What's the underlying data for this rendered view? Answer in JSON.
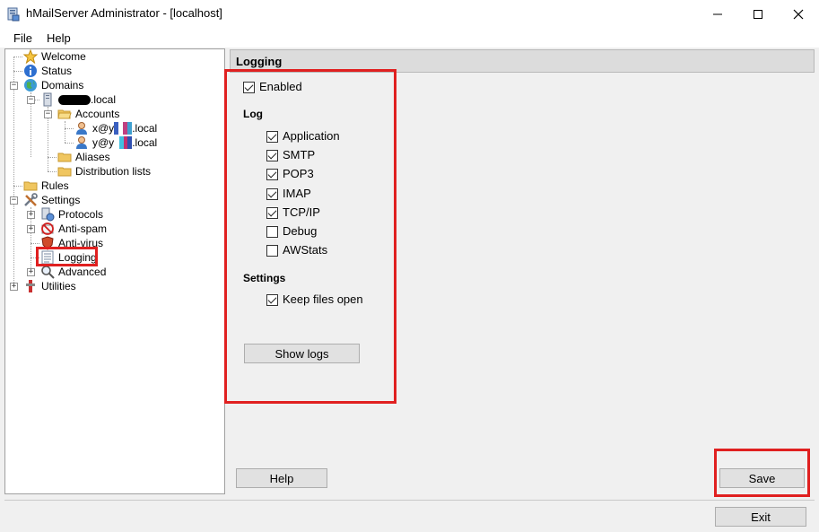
{
  "window": {
    "title": "hMailServer Administrator - [localhost]",
    "icons": [
      "app-icon",
      "minimize-icon",
      "maximize-icon",
      "close-icon"
    ]
  },
  "menu": {
    "file": "File",
    "help": "Help"
  },
  "tree": {
    "welcome": "Welcome",
    "status": "Status",
    "domains": "Domains",
    "domain_name": ".local",
    "accounts": "Accounts",
    "account1_prefix": "x@y",
    "account1_suffix": ".local",
    "account2_prefix": "y@y",
    "account2_suffix": ".local",
    "aliases": "Aliases",
    "distribution_lists": "Distribution lists",
    "rules": "Rules",
    "settings": "Settings",
    "protocols": "Protocols",
    "anti_spam": "Anti-spam",
    "anti_virus": "Anti-virus",
    "logging": "Logging",
    "advanced": "Advanced",
    "utilities": "Utilities",
    "expander_plus": "+",
    "expander_minus": "−"
  },
  "panel": {
    "header": "Logging",
    "enabled": {
      "label": "Enabled",
      "checked": true
    },
    "log_group": "Log",
    "log_items": [
      {
        "label": "Application",
        "checked": true
      },
      {
        "label": "SMTP",
        "checked": true
      },
      {
        "label": "POP3",
        "checked": true
      },
      {
        "label": "IMAP",
        "checked": true
      },
      {
        "label": "TCP/IP",
        "checked": true
      },
      {
        "label": "Debug",
        "checked": false
      },
      {
        "label": "AWStats",
        "checked": false
      }
    ],
    "settings_group": "Settings",
    "keep_files_open": {
      "label": "Keep files open",
      "checked": true
    },
    "show_logs": "Show logs",
    "help": "Help",
    "save": "Save",
    "exit": "Exit"
  },
  "colors": {
    "highlight_red": "#e02020",
    "header_gray": "#dcdcdc",
    "button_face": "#e1e1e1"
  }
}
